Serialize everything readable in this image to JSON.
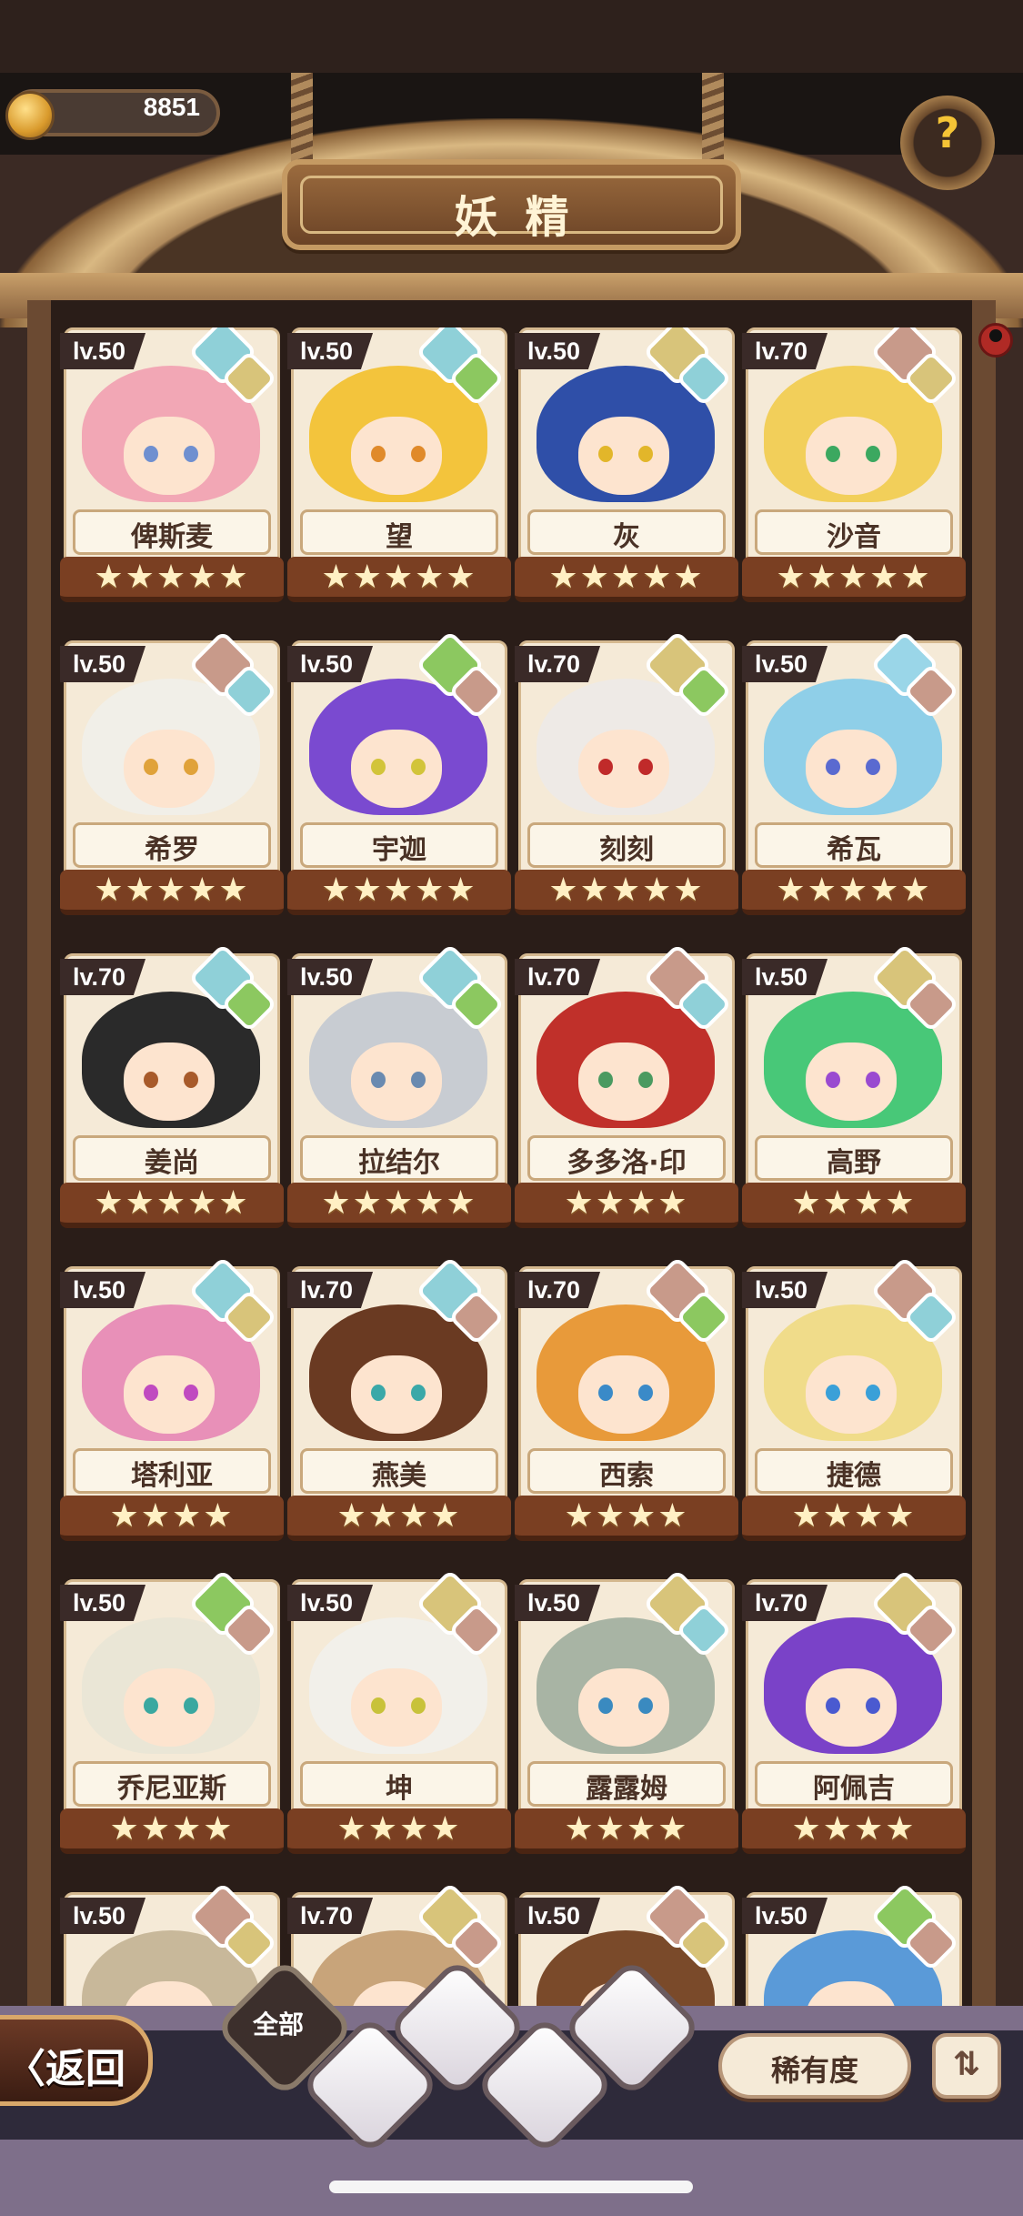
{
  "header": {
    "coin_value": "8851",
    "title": "妖精",
    "help_label": "?",
    "coin_icon": "crown-coin-icon"
  },
  "colors": {
    "water": "#8fd0d8",
    "earth": "#d8c47a",
    "nature": "#8cc860",
    "mountain": "#c89a8a",
    "sky": "#9ad6e8",
    "level_badge": "#3a2a28",
    "star_bar": "#7a3f22"
  },
  "fairies": [
    {
      "level": "lv.50",
      "name": "俾斯麦",
      "stars": "★★★★★",
      "elements": [
        "water",
        "earth"
      ],
      "hair": "#f2a7b5",
      "eye": "#6f8fd0"
    },
    {
      "level": "lv.50",
      "name": "望",
      "stars": "★★★★★",
      "elements": [
        "water",
        "nature"
      ],
      "hair": "#f3c43c",
      "eye": "#e08a2a"
    },
    {
      "level": "lv.50",
      "name": "灰",
      "stars": "★★★★★",
      "elements": [
        "earth",
        "water"
      ],
      "hair": "#2f4fa8",
      "eye": "#e2b62a"
    },
    {
      "level": "lv.70",
      "name": "沙音",
      "stars": "★★★★★",
      "elements": [
        "mountain",
        "earth"
      ],
      "hair": "#f2cf5a",
      "eye": "#3ca860"
    },
    {
      "level": "lv.50",
      "name": "希罗",
      "stars": "★★★★★",
      "elements": [
        "mountain",
        "water"
      ],
      "hair": "#f1efe8",
      "eye": "#e0a23a"
    },
    {
      "level": "lv.50",
      "name": "宇迦",
      "stars": "★★★★★",
      "elements": [
        "nature",
        "mountain"
      ],
      "hair": "#7a4ad0",
      "eye": "#d2c43a"
    },
    {
      "level": "lv.70",
      "name": "刻刻",
      "stars": "★★★★★",
      "elements": [
        "earth",
        "nature"
      ],
      "hair": "#eeeae6",
      "eye": "#c02a2a"
    },
    {
      "level": "lv.50",
      "name": "希瓦",
      "stars": "★★★★★",
      "elements": [
        "sky",
        "mountain"
      ],
      "hair": "#8fcfe8",
      "eye": "#5a6ad0"
    },
    {
      "level": "lv.70",
      "name": "姜尚",
      "stars": "★★★★★",
      "elements": [
        "water",
        "nature"
      ],
      "hair": "#2a2a2a",
      "eye": "#a85a2a"
    },
    {
      "level": "lv.50",
      "name": "拉结尔",
      "stars": "★★★★★",
      "elements": [
        "water",
        "nature"
      ],
      "hair": "#c8ccd2",
      "eye": "#6a8ab0"
    },
    {
      "level": "lv.70",
      "name": "多多洛·印",
      "stars": "★★★★",
      "elements": [
        "mountain",
        "water"
      ],
      "hair": "#c0302a",
      "eye": "#4a9a60"
    },
    {
      "level": "lv.50",
      "name": "高野",
      "stars": "★★★★",
      "elements": [
        "earth",
        "mountain"
      ],
      "hair": "#48c878",
      "eye": "#9a4ad0"
    },
    {
      "level": "lv.50",
      "name": "塔利亚",
      "stars": "★★★★",
      "elements": [
        "water",
        "earth"
      ],
      "hair": "#e890b8",
      "eye": "#c04ac0"
    },
    {
      "level": "lv.70",
      "name": "燕美",
      "stars": "★★★★",
      "elements": [
        "water",
        "mountain"
      ],
      "hair": "#6a3a22",
      "eye": "#3aa8a8"
    },
    {
      "level": "lv.70",
      "name": "西索",
      "stars": "★★★★",
      "elements": [
        "mountain",
        "nature"
      ],
      "hair": "#e89a3a",
      "eye": "#3a8ac8"
    },
    {
      "level": "lv.50",
      "name": "捷德",
      "stars": "★★★★",
      "elements": [
        "mountain",
        "water"
      ],
      "hair": "#f0dc8a",
      "eye": "#3aa0d8"
    },
    {
      "level": "lv.50",
      "name": "乔尼亚斯",
      "stars": "★★★★",
      "elements": [
        "nature",
        "mountain"
      ],
      "hair": "#eae6d6",
      "eye": "#3aa8a0"
    },
    {
      "level": "lv.50",
      "name": "坤",
      "stars": "★★★★",
      "elements": [
        "earth",
        "mountain"
      ],
      "hair": "#f2f0ea",
      "eye": "#c8c23a"
    },
    {
      "level": "lv.50",
      "name": "露露姆",
      "stars": "★★★★",
      "elements": [
        "earth",
        "water"
      ],
      "hair": "#a8b4a4",
      "eye": "#3a8ac0"
    },
    {
      "level": "lv.70",
      "name": "阿佩吉",
      "stars": "★★★★",
      "elements": [
        "earth",
        "mountain"
      ],
      "hair": "#7a42c8",
      "eye": "#4a5ad0"
    },
    {
      "level": "lv.50",
      "name": "",
      "stars": "",
      "elements": [
        "mountain",
        "earth"
      ],
      "hair": "#c8b89a",
      "eye": "#6a5a4a"
    },
    {
      "level": "lv.70",
      "name": "",
      "stars": "",
      "elements": [
        "earth",
        "mountain"
      ],
      "hair": "#c8a47a",
      "eye": "#4a3a2a"
    },
    {
      "level": "lv.50",
      "name": "",
      "stars": "",
      "elements": [
        "mountain",
        "earth"
      ],
      "hair": "#7a4a2a",
      "eye": "#4a3a2a"
    },
    {
      "level": "lv.50",
      "name": "",
      "stars": "",
      "elements": [
        "nature",
        "mountain"
      ],
      "hair": "#5a9ad8",
      "eye": "#4a6ad0"
    }
  ],
  "footer": {
    "back_label": "〈返回",
    "filter_all_label": "全部",
    "filters": [
      {
        "name": "filter-all",
        "icon": ""
      },
      {
        "name": "filter-nature",
        "icon": "sprout-icon"
      },
      {
        "name": "filter-water",
        "icon": "droplet-icon"
      },
      {
        "name": "filter-earth",
        "icon": "rock-icon"
      },
      {
        "name": "filter-mountain",
        "icon": "mountain-icon"
      }
    ],
    "sort_label": "稀有度",
    "order_label": "⇅"
  }
}
